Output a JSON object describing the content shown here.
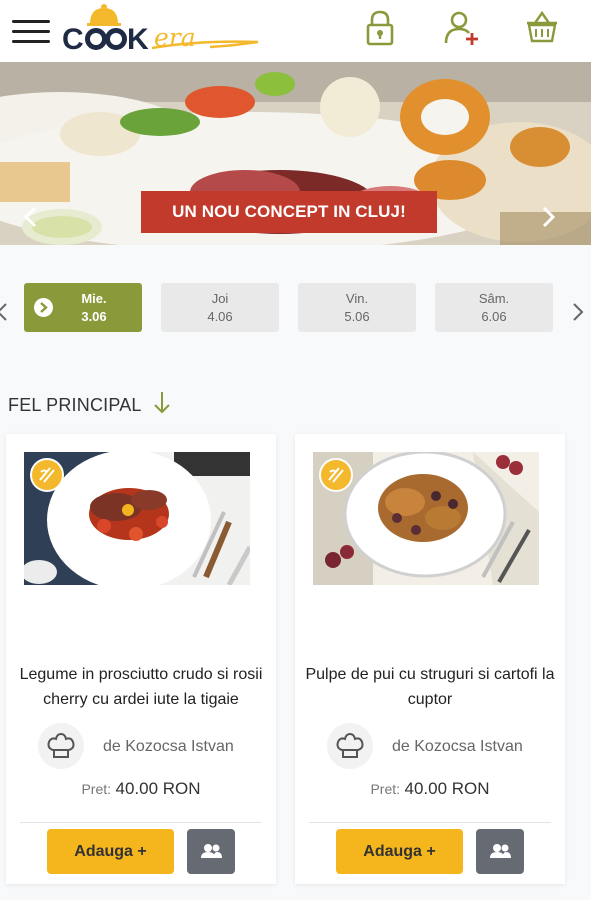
{
  "header": {
    "logo_text": "COOKera",
    "menu_icon": "hamburger-menu-icon",
    "icons": [
      "lock-icon",
      "add-user-icon",
      "basket-icon"
    ],
    "accent": "#8a9a3a",
    "brand_yellow": "#f3b82c"
  },
  "hero": {
    "banner_text": "UN NOU CONCEPT IN CLUJ!",
    "banner_color": "#c23a2c"
  },
  "days": [
    {
      "name": "Mie.",
      "date": "3.06",
      "active": true
    },
    {
      "name": "Joi",
      "date": "4.06",
      "active": false
    },
    {
      "name": "Vin.",
      "date": "5.06",
      "active": false
    },
    {
      "name": "Sâm.",
      "date": "6.06",
      "active": false
    }
  ],
  "section": {
    "title": "FEL PRINCIPAL"
  },
  "cards": [
    {
      "title": "Legume in prosciutto crudo si rosii cherry cu ardei iute la tigaie",
      "chef": "de Kozocsa Istvan",
      "price_label": "Pret:",
      "price": "40.00 RON",
      "add_label": "Adauga +"
    },
    {
      "title": "Pulpe de pui cu struguri si cartofi la cuptor",
      "chef": "de Kozocsa Istvan",
      "price_label": "Pret:",
      "price": "40.00 RON",
      "add_label": "Adauga +"
    }
  ]
}
